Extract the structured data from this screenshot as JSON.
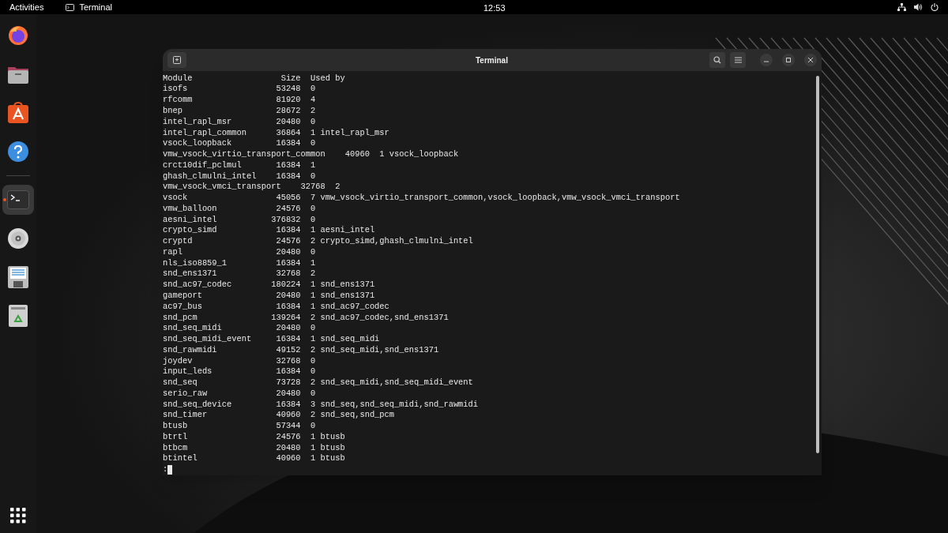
{
  "top_bar": {
    "activities": "Activities",
    "app_name": "Terminal",
    "clock": "12:53"
  },
  "dock": {
    "items": [
      {
        "kind": "browser",
        "running": false
      },
      {
        "kind": "files",
        "running": false
      },
      {
        "kind": "software",
        "running": false
      },
      {
        "kind": "help",
        "running": false
      },
      {
        "kind": "separator"
      },
      {
        "kind": "terminal",
        "running": true
      },
      {
        "kind": "disc",
        "running": false
      },
      {
        "kind": "floppy",
        "running": false
      },
      {
        "kind": "trash",
        "running": false
      }
    ]
  },
  "window": {
    "title": "Terminal",
    "header": {
      "module": "Module",
      "size": "Size",
      "used_by": "Used by"
    },
    "rows": [
      {
        "module": "isofs",
        "size": "53248",
        "used": "0"
      },
      {
        "module": "rfcomm",
        "size": "81920",
        "used": "4"
      },
      {
        "module": "bnep",
        "size": "28672",
        "used": "2"
      },
      {
        "module": "intel_rapl_msr",
        "size": "20480",
        "used": "0"
      },
      {
        "module": "intel_rapl_common",
        "size": "36864",
        "used": "1 intel_rapl_msr"
      },
      {
        "module": "vsock_loopback",
        "size": "16384",
        "used": "0"
      },
      {
        "module": "vmw_vsock_virtio_transport_common",
        "size": "40960",
        "used": "1 vsock_loopback"
      },
      {
        "module": "crct10dif_pclmul",
        "size": "16384",
        "used": "1"
      },
      {
        "module": "ghash_clmulni_intel",
        "size": "16384",
        "used": "0"
      },
      {
        "module": "vmw_vsock_vmci_transport",
        "size": "32768",
        "used": "2"
      },
      {
        "module": "vsock",
        "size": "45056",
        "used": "7 vmw_vsock_virtio_transport_common,vsock_loopback,vmw_vsock_vmci_transport"
      },
      {
        "module": "vmw_balloon",
        "size": "24576",
        "used": "0"
      },
      {
        "module": "aesni_intel",
        "size": "376832",
        "used": "0"
      },
      {
        "module": "crypto_simd",
        "size": "16384",
        "used": "1 aesni_intel"
      },
      {
        "module": "cryptd",
        "size": "24576",
        "used": "2 crypto_simd,ghash_clmulni_intel"
      },
      {
        "module": "rapl",
        "size": "20480",
        "used": "0"
      },
      {
        "module": "nls_iso8859_1",
        "size": "16384",
        "used": "1"
      },
      {
        "module": "snd_ens1371",
        "size": "32768",
        "used": "2"
      },
      {
        "module": "snd_ac97_codec",
        "size": "180224",
        "used": "1 snd_ens1371"
      },
      {
        "module": "gameport",
        "size": "20480",
        "used": "1 snd_ens1371"
      },
      {
        "module": "ac97_bus",
        "size": "16384",
        "used": "1 snd_ac97_codec"
      },
      {
        "module": "snd_pcm",
        "size": "139264",
        "used": "2 snd_ac97_codec,snd_ens1371"
      },
      {
        "module": "snd_seq_midi",
        "size": "20480",
        "used": "0"
      },
      {
        "module": "snd_seq_midi_event",
        "size": "16384",
        "used": "1 snd_seq_midi"
      },
      {
        "module": "snd_rawmidi",
        "size": "49152",
        "used": "2 snd_seq_midi,snd_ens1371"
      },
      {
        "module": "joydev",
        "size": "32768",
        "used": "0"
      },
      {
        "module": "input_leds",
        "size": "16384",
        "used": "0"
      },
      {
        "module": "snd_seq",
        "size": "73728",
        "used": "2 snd_seq_midi,snd_seq_midi_event"
      },
      {
        "module": "serio_raw",
        "size": "20480",
        "used": "0"
      },
      {
        "module": "snd_seq_device",
        "size": "16384",
        "used": "3 snd_seq,snd_seq_midi,snd_rawmidi"
      },
      {
        "module": "snd_timer",
        "size": "40960",
        "used": "2 snd_seq,snd_pcm"
      },
      {
        "module": "btusb",
        "size": "57344",
        "used": "0"
      },
      {
        "module": "btrtl",
        "size": "24576",
        "used": "1 btusb"
      },
      {
        "module": "btbcm",
        "size": "20480",
        "used": "1 btusb"
      },
      {
        "module": "btintel",
        "size": "40960",
        "used": "1 btusb"
      }
    ],
    "prompt": ":"
  }
}
